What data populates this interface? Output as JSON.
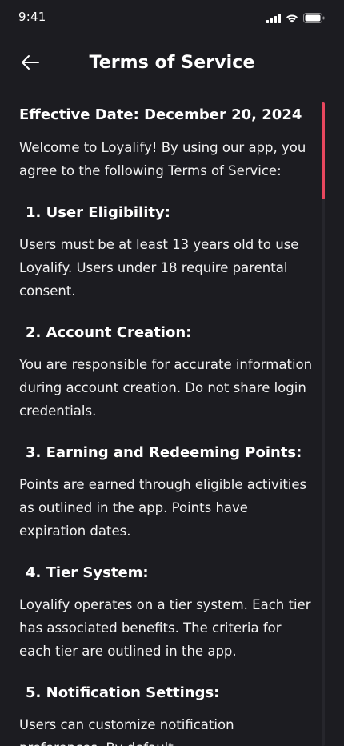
{
  "status_bar": {
    "time": "9:41",
    "icons": [
      "cellular-signal-icon",
      "wifi-icon",
      "battery-icon"
    ]
  },
  "header": {
    "title": "Terms of Service",
    "back_icon": "arrow-left-icon"
  },
  "content": {
    "effective_date": "Effective Date: December 20, 2024",
    "intro": "Welcome to Loyalify! By using our app, you agree to the following Terms of Service:",
    "sections": [
      {
        "heading": "1. User Eligibility:",
        "body": "Users must be at least 13 years old to use Loyalify. Users under 18 require parental consent."
      },
      {
        "heading": "2. Account Creation:",
        "body": "You are responsible for accurate information during account creation. Do not share login credentials."
      },
      {
        "heading": "3. Earning and Redeeming Points:",
        "body": "Points are earned through eligible activities as outlined in the app. Points have expiration dates."
      },
      {
        "heading": "4. Tier System:",
        "body": "Loyalify operates on a tier system. Each tier has associated benefits. The criteria for each tier are outlined in the app."
      },
      {
        "heading": "5. Notification Settings:",
        "body": "Users can customize notification preferences. By default,"
      }
    ]
  },
  "scrollbar": {
    "position_fraction": 0.0,
    "visible_fraction": 0.15
  },
  "colors": {
    "background": "#1c1c21",
    "text": "#ffffff",
    "accent": "#e8475e"
  }
}
